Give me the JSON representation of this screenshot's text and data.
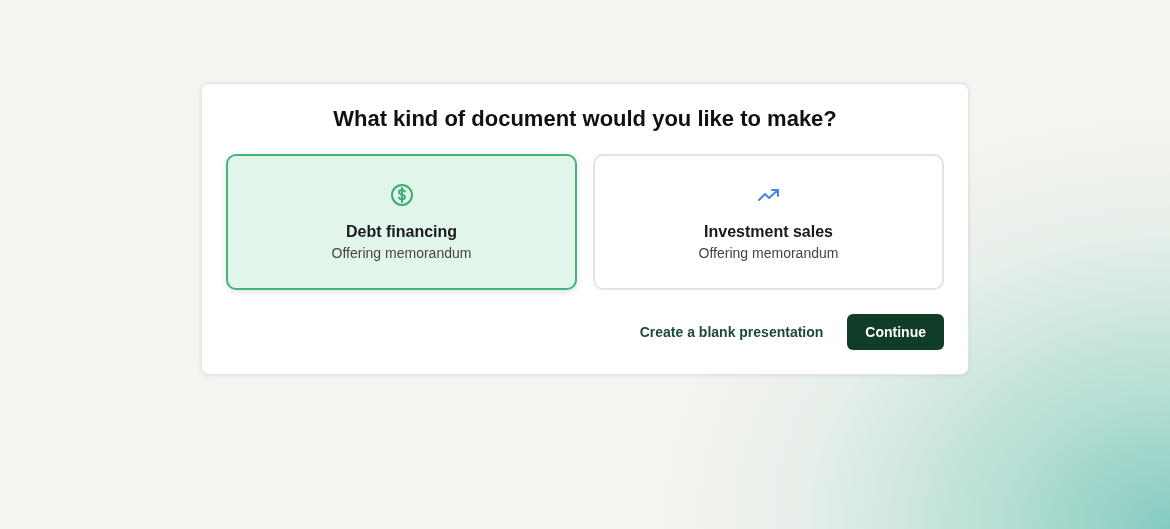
{
  "dialog": {
    "title": "What kind of document would you like to make?",
    "options": [
      {
        "kind": "dollar",
        "label": "Debt financing",
        "sublabel": "Offering memorandum",
        "selected": true
      },
      {
        "kind": "trend",
        "label": "Investment sales",
        "sublabel": "Offering memorandum",
        "selected": false
      }
    ],
    "secondary_action": "Create a blank presentation",
    "primary_action": "Continue"
  }
}
